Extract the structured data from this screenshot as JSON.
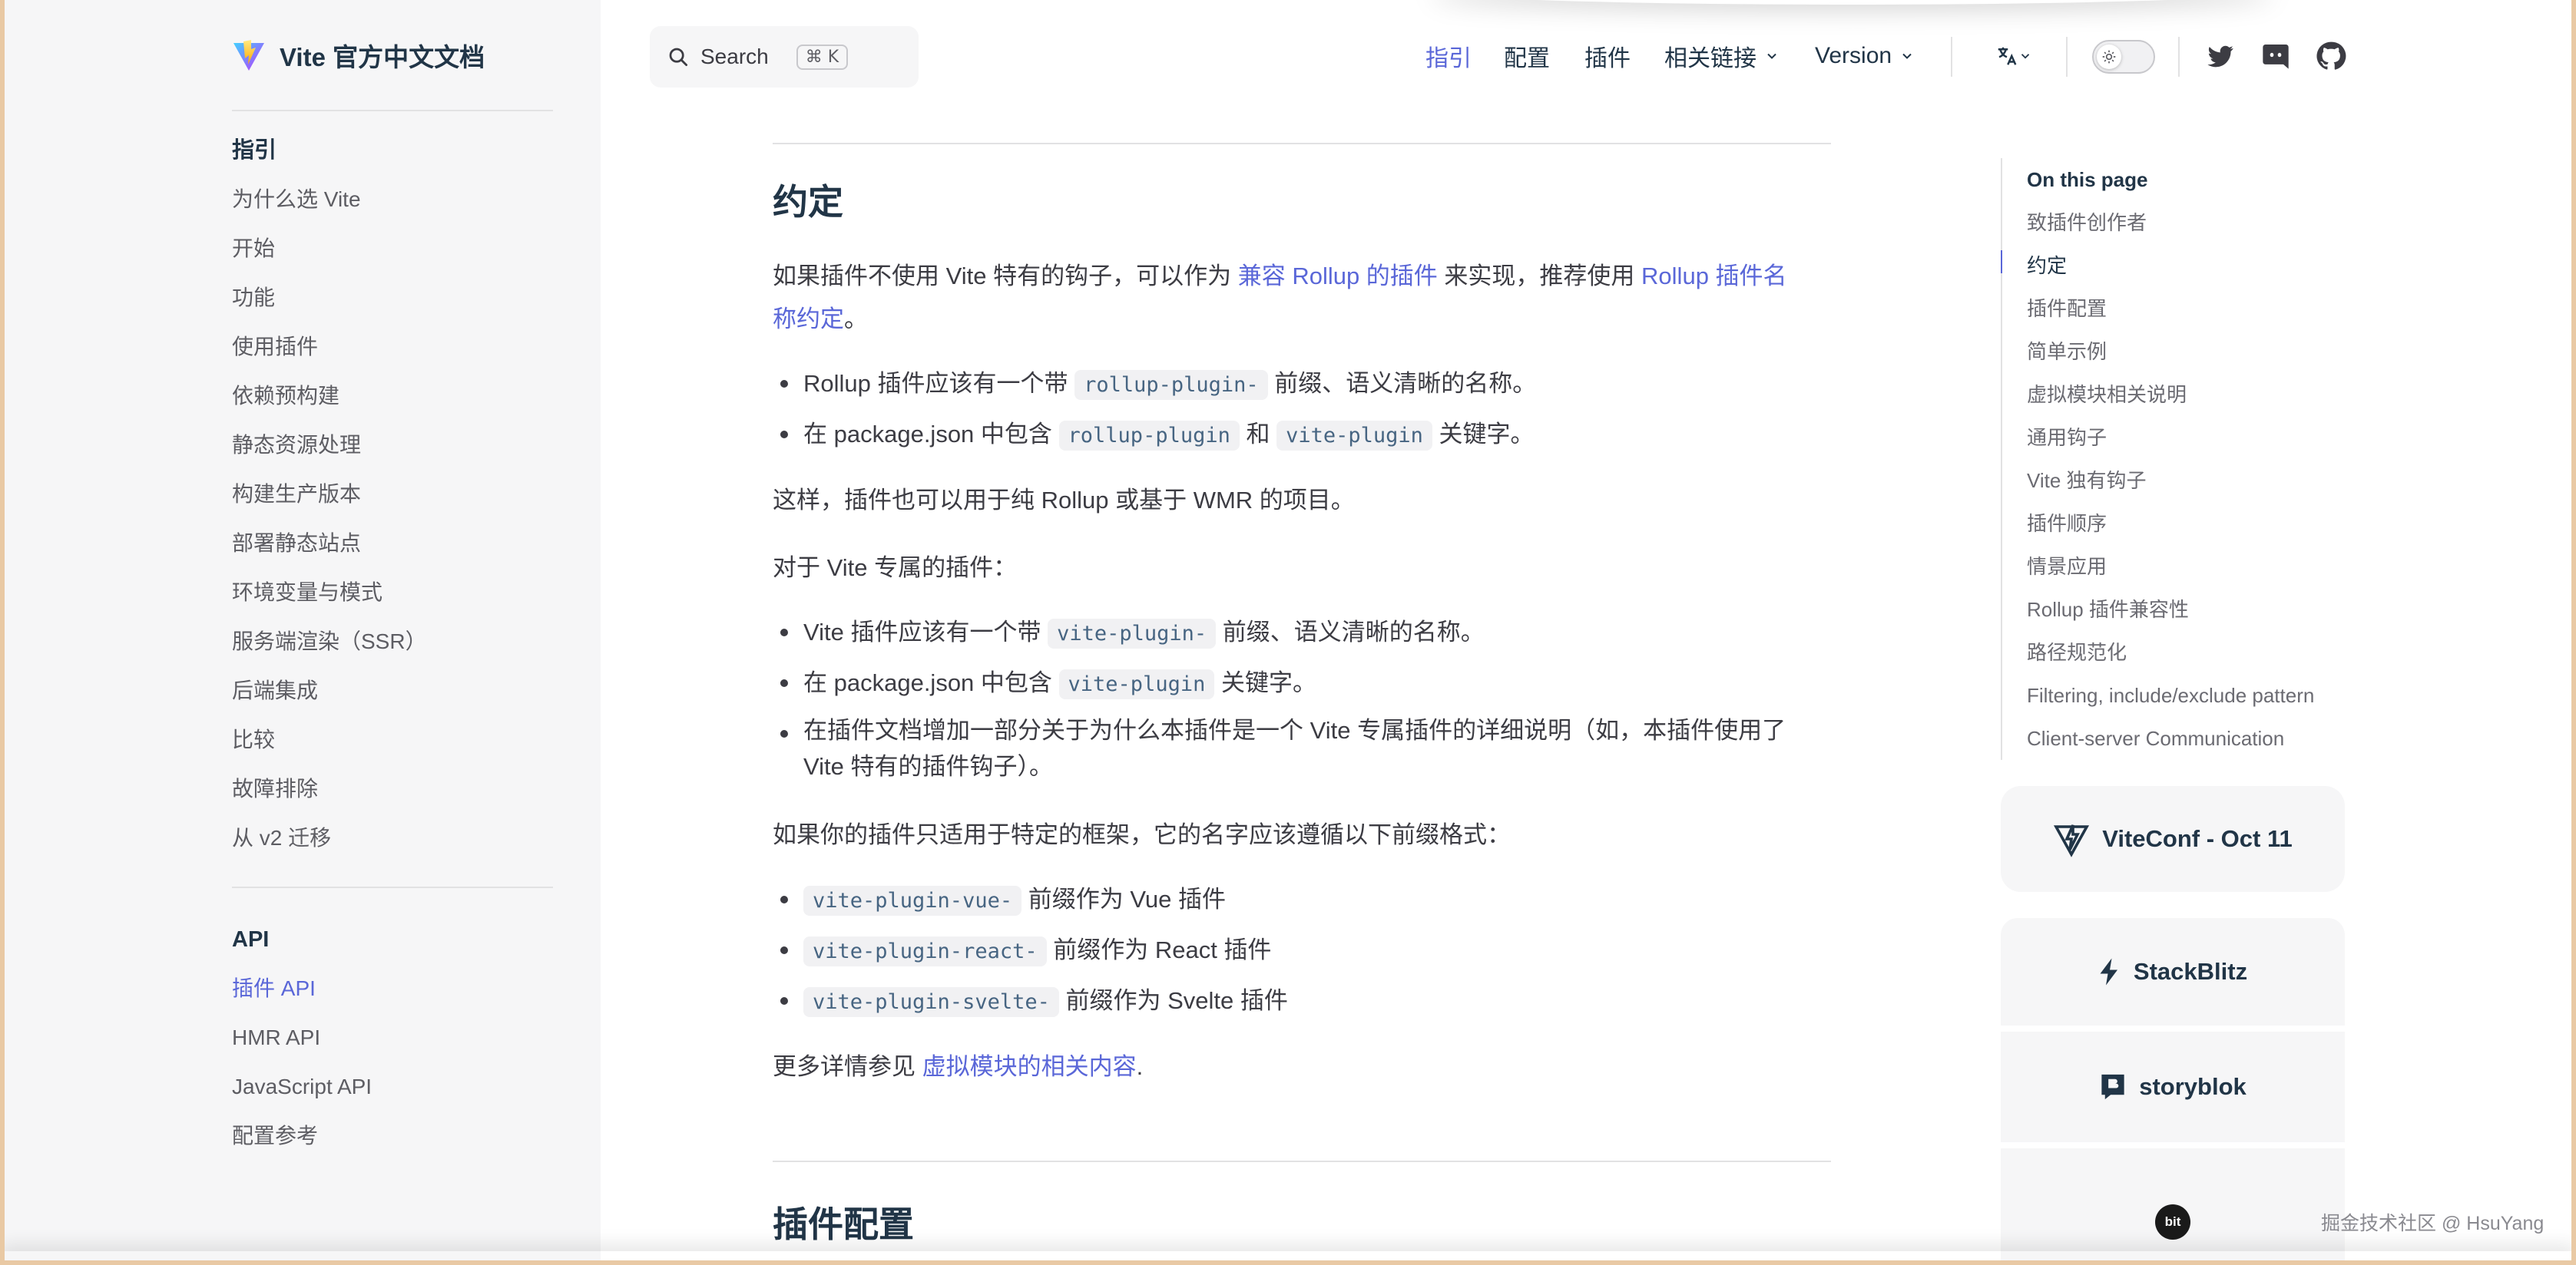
{
  "site": {
    "title": "Vite 官方中文文档"
  },
  "sidebar": {
    "groups": [
      {
        "heading": "指引",
        "items": [
          "为什么选 Vite",
          "开始",
          "功能",
          "使用插件",
          "依赖预构建",
          "静态资源处理",
          "构建生产版本",
          "部署静态站点",
          "环境变量与模式",
          "服务端渲染（SSR）",
          "后端集成",
          "比较",
          "故障排除",
          "从 v2 迁移"
        ]
      },
      {
        "heading": "API",
        "items": [
          "插件 API",
          "HMR API",
          "JavaScript API",
          "配置参考"
        ],
        "active": "插件 API"
      }
    ]
  },
  "topbar": {
    "search_label": "Search",
    "search_shortcut": "⌘ K",
    "menu": [
      "指引",
      "配置",
      "插件",
      "相关链接",
      "Version"
    ],
    "menu_active": "指引",
    "icons": [
      "translate-icon",
      "theme-toggle",
      "twitter-icon",
      "discord-icon",
      "github-icon"
    ]
  },
  "article": {
    "h2_conventions": "约定",
    "p1_prefix": "如果插件不使用 Vite 特有的钩子，可以作为 ",
    "p1_link1": "兼容 Rollup 的插件",
    "p1_mid": " 来实现，推荐使用 ",
    "p1_link2a": "Rollup 插件名",
    "p1_link2b": "称约定",
    "p1_suffix": "。",
    "rollup_list": [
      {
        "pre": "Rollup 插件应该有一个带 ",
        "code": "rollup-plugin-",
        "post": " 前缀、语义清晰的名称。"
      },
      {
        "pre": "在 package.json 中包含 ",
        "code": "rollup-plugin",
        "mid": " 和 ",
        "code2": "vite-plugin",
        "post": " 关键字。"
      }
    ],
    "p2": "这样，插件也可以用于纯 Rollup 或基于 WMR 的项目。",
    "p3": "对于 Vite 专属的插件：",
    "vite_list": [
      {
        "pre": "Vite 插件应该有一个带 ",
        "code": "vite-plugin-",
        "post": " 前缀、语义清晰的名称。"
      },
      {
        "pre": "在 package.json 中包含 ",
        "code": "vite-plugin",
        "post": " 关键字。"
      },
      {
        "line1": "在插件文档增加一部分关于为什么本插件是一个 Vite 专属插件的详细说明（如，本插件使用了",
        "line2": "Vite 特有的插件钩子）。"
      }
    ],
    "p4": "如果你的插件只适用于特定的框架，它的名字应该遵循以下前缀格式：",
    "framework_list": [
      {
        "code": "vite-plugin-vue-",
        "post": " 前缀作为 Vue 插件"
      },
      {
        "code": "vite-plugin-react-",
        "post": " 前缀作为 React 插件"
      },
      {
        "code": "vite-plugin-svelte-",
        "post": " 前缀作为 Svelte 插件"
      }
    ],
    "p5_prefix": "更多详情参见 ",
    "p5_link": "虚拟模块的相关内容",
    "p5_suffix": ".",
    "h2_config": "插件配置"
  },
  "toc": {
    "title": "On this page",
    "items": [
      "致插件创作者",
      "约定",
      "插件配置",
      "简单示例",
      "虚拟模块相关说明",
      "通用钩子",
      "Vite 独有钩子",
      "插件顺序",
      "情景应用",
      "Rollup 插件兼容性",
      "路径规范化",
      "Filtering, include/exclude pattern",
      "Client-server Communication"
    ],
    "active": "约定"
  },
  "sponsors": {
    "viteconf": "ViteConf - Oct 11",
    "stackblitz": "StackBlitz",
    "storyblok": "storyblok",
    "bit": "bit"
  },
  "watermark": "掘金技术社区 @ HsuYang",
  "colors": {
    "brand": "#5a67d8",
    "text": "#3c3c43",
    "heading": "#213547",
    "sidebar_bg": "#f6f6f7",
    "frame": "#e9c9a4"
  }
}
